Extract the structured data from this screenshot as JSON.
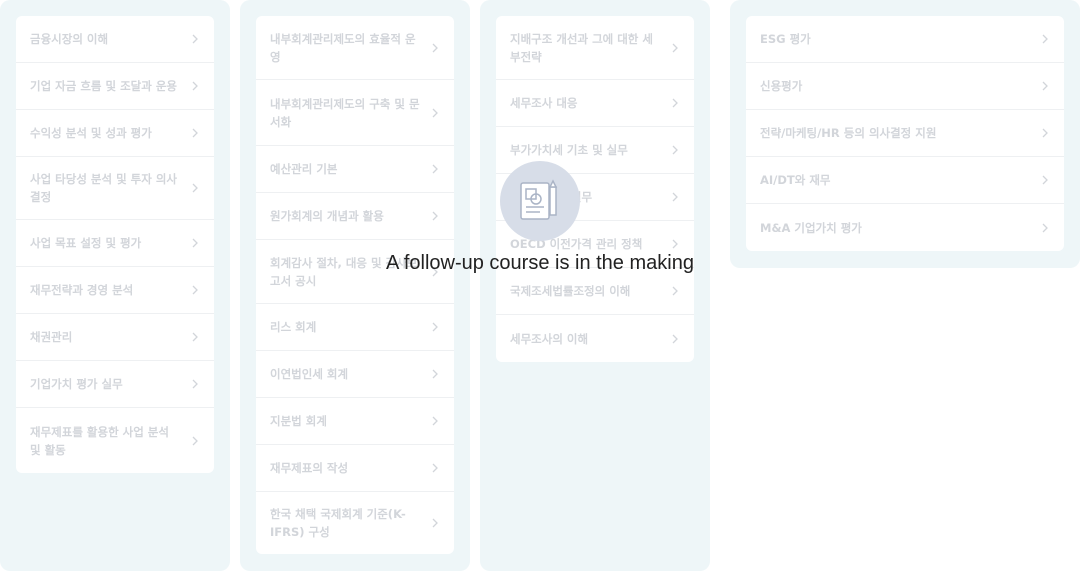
{
  "columns": [
    {
      "items": [
        "금융시장의 이해",
        "기업 자금 흐름 및 조달과 운용",
        "수익성 분석 및 성과 평가",
        "사업 타당성 분석 및 투자 의사결정",
        "사업 목표 설정 및 평가",
        "재무전략과 경영 분석",
        "채권관리",
        "기업가치 평가 실무",
        "재무제표를 활용한 사업 분석 및 활동"
      ]
    },
    {
      "items": [
        "내부회계관리제도의 효율적 운영",
        "내부회계관리제도의 구축 및 문서화",
        "예산관리 기본",
        "원가회계의 개념과 활용",
        "회계감사 절차, 대응 및 감사보고서 공시",
        "리스 회계",
        "이연법인세 회계",
        "지분법 회계",
        "재무제표의 작성",
        "한국 채택 국제회계 기준(K-IFRS) 구성"
      ]
    },
    {
      "items": [
        "지배구조 개선과 그에 대한 세부전략",
        "세무조사 대응",
        "부가가치세 기초 및 실무",
        "법인세 신고 실무",
        "OECD 이전가격 관리 정책",
        "국제조세법률조정의 이해",
        "세무조사의 이해"
      ]
    },
    {
      "items": [
        "ESG 평가",
        "신용평가",
        "전략/마케팅/HR 등의 의사결정 지원",
        "AI/DT와 재무",
        "M&A 기업가치 평가"
      ]
    }
  ],
  "overlay": {
    "icon": "document-pencil-icon",
    "message": "A follow-up course is in the making"
  }
}
